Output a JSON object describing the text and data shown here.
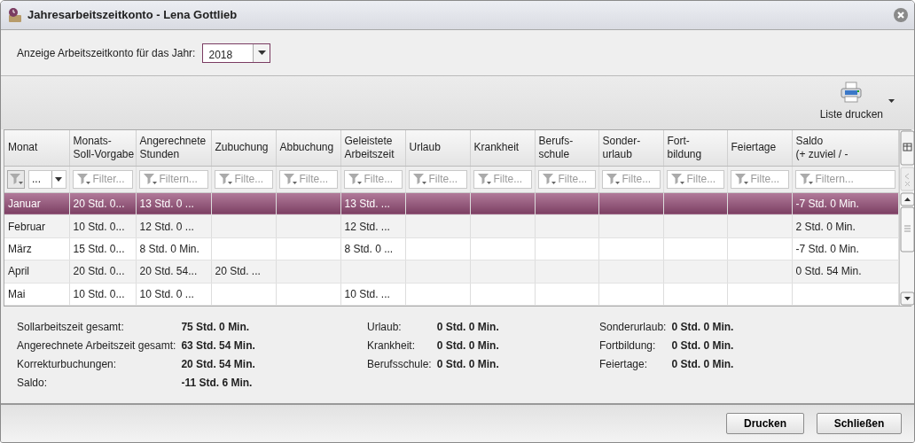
{
  "window": {
    "title": "Jahresarbeitszeitkonto - Lena Gottlieb"
  },
  "year_selector": {
    "label": "Anzeige Arbeitszeitkonto für das Jahr:",
    "value": "2018"
  },
  "toolbar": {
    "print_list_button": "Liste drucken"
  },
  "table": {
    "columns": [
      "Monat",
      "Monats-\nSoll-Vorgabe",
      "Angerechnete\nStunden",
      "Zubuchung",
      "Abbuchung",
      "Geleistete\nArbeitszeit",
      "Urlaub",
      "Krankheit",
      "Berufs-\nschule",
      "Sonder-\nurlaub",
      "Fort-\nbildung",
      "Feiertage",
      "Saldo\n(+ zuviel / -"
    ],
    "first_filter": {
      "value": "..."
    },
    "filters": [
      "Filter...",
      "Filtern...",
      "Filte...",
      "Filte...",
      "Filte...",
      "Filte...",
      "Filte...",
      "Filte...",
      "Filte...",
      "Filte...",
      "Filte...",
      "Filtern..."
    ],
    "rows": [
      {
        "selected": true,
        "cells": [
          "Januar",
          "20 Std. 0...",
          "13 Std. 0 ...",
          null,
          null,
          "13 Std. ...",
          null,
          null,
          null,
          null,
          null,
          null,
          "-7 Std. 0 Min."
        ]
      },
      {
        "selected": false,
        "cells": [
          "Februar",
          "10 Std. 0...",
          "12 Std. 0 ...",
          null,
          null,
          "12 Std. ...",
          null,
          null,
          null,
          null,
          null,
          null,
          "2 Std. 0 Min."
        ]
      },
      {
        "selected": false,
        "cells": [
          "März",
          "15 Std. 0...",
          "8 Std. 0 Min.",
          null,
          null,
          "8 Std. 0 ...",
          null,
          null,
          null,
          null,
          null,
          null,
          "-7 Std. 0 Min."
        ]
      },
      {
        "selected": false,
        "cells": [
          "April",
          "20 Std. 0...",
          "20 Std. 54...",
          "20 Std. ...",
          null,
          null,
          null,
          null,
          null,
          null,
          null,
          null,
          "0 Std. 54 Min."
        ]
      },
      {
        "selected": false,
        "cells": [
          "Mai",
          "10 Std. 0...",
          "10 Std. 0 ...",
          null,
          null,
          "10 Std. ...",
          null,
          null,
          null,
          null,
          null,
          null,
          null
        ]
      }
    ]
  },
  "summary": [
    [
      {
        "label": "Sollarbeitszeit gesamt:",
        "value": "75 Std. 0 Min."
      },
      {
        "label": "Angerechnete Arbeitszeit gesamt:",
        "value": "63 Std. 54 Min."
      },
      {
        "label": "Korrekturbuchungen:",
        "value": "20 Std. 54 Min."
      },
      {
        "label": "Saldo:",
        "value": "-11 Std. 6 Min."
      }
    ],
    [
      {
        "label": "Urlaub:",
        "value": "0 Std. 0 Min."
      },
      {
        "label": "Krankheit:",
        "value": "0 Std. 0 Min."
      },
      {
        "label": "Berufsschule:",
        "value": "0 Std. 0 Min."
      }
    ],
    [
      {
        "label": "Sonderurlaub:",
        "value": "0 Std. 0 Min."
      },
      {
        "label": "Fortbildung:",
        "value": "0 Std. 0 Min."
      },
      {
        "label": "Feiertage:",
        "value": "0 Std. 0 Min."
      }
    ]
  ],
  "buttons": [
    "Drucken",
    "Schließen"
  ]
}
